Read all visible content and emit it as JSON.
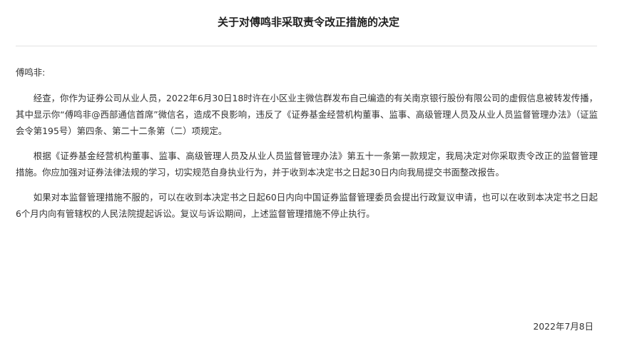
{
  "document": {
    "title": "关于对傅鸣非采取责令改正措施的决定",
    "salutation": "傅鸣非:",
    "paragraphs": [
      "经查，你作为证券公司从业人员，2022年6月30日18时许在小区业主微信群发布自己编造的有关南京银行股份有限公司的虚假信息被转发传播，其中显示你“傅鸣非@西部通信首席”微信名，造成不良影响，违反了《证券基金经营机构董事、监事、高级管理人员及从业人员监督管理办法》（证监会令第195号）第四条、第二十二条第（二）项规定。",
      "根据《证券基金经营机构董事、监事、高级管理人员及从业人员监督管理办法》第五十一条第一款规定，我局决定对你采取责令改正的监督管理措施。你应加强对证券法律法规的学习，切实规范自身执业行为，并于收到本决定书之日起30日内向我局提交书面整改报告。",
      "如果对本监督管理措施不服的，可以在收到本决定书之日起60日内向中国证券监督管理委员会提出行政复议申请，也可以在收到本决定书之日起6个月内向有管辖权的人民法院提起诉讼。复议与诉讼期间，上述监督管理措施不停止执行。"
    ],
    "date": "2022年7月8日"
  }
}
